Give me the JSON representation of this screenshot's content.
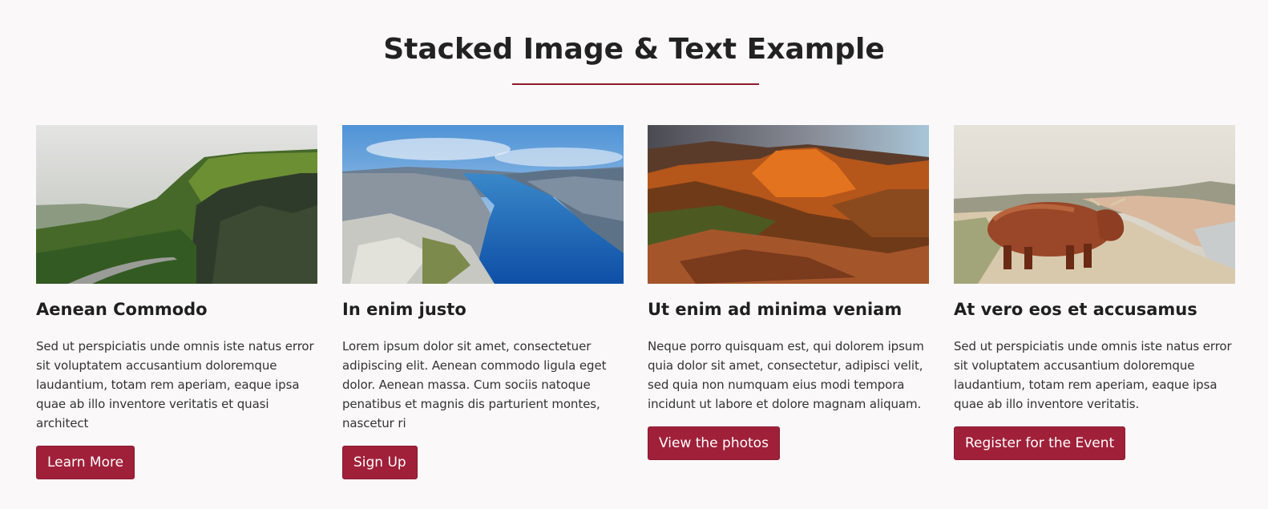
{
  "section": {
    "title": "Stacked Image & Text Example",
    "accent_color": "#8e1b2c",
    "button_color": "#a0203a"
  },
  "cards": [
    {
      "heading": "Aenean Commodo",
      "text": "Sed ut perspiciatis unde omnis iste natus error sit voluptatem accusantium doloremque laudantium, totam rem aperiam, eaque ipsa quae ab illo inventore veritatis et quasi architect",
      "button": "Learn More",
      "image": "green-mountain-cliffs-photo"
    },
    {
      "heading": "In enim justo",
      "text": "Lorem ipsum dolor sit amet, consectetuer adipiscing elit. Aenean commodo ligula eget dolor. Aenean massa. Cum sociis natoque penatibus et magnis dis parturient montes, nascetur ri",
      "button": "Sign Up",
      "image": "blue-fjord-photo"
    },
    {
      "heading": "Ut enim ad minima veniam",
      "text": "Neque porro quisquam est, qui dolorem ipsum quia dolor sit amet, consectetur, adipisci velit, sed quia non numquam eius modi tempora incidunt ut labore et dolore magnam aliquam.",
      "button": "View the photos",
      "image": "orange-canyon-photo"
    },
    {
      "heading": "At vero eos et accusamus",
      "text": "Sed ut perspiciatis unde omnis iste natus error sit voluptatem accusantium doloremque laudantium, totam rem aperiam, eaque ipsa quae ab illo inventore veritatis.",
      "button": "Register for the Event",
      "image": "highland-cow-beach-photo"
    }
  ]
}
